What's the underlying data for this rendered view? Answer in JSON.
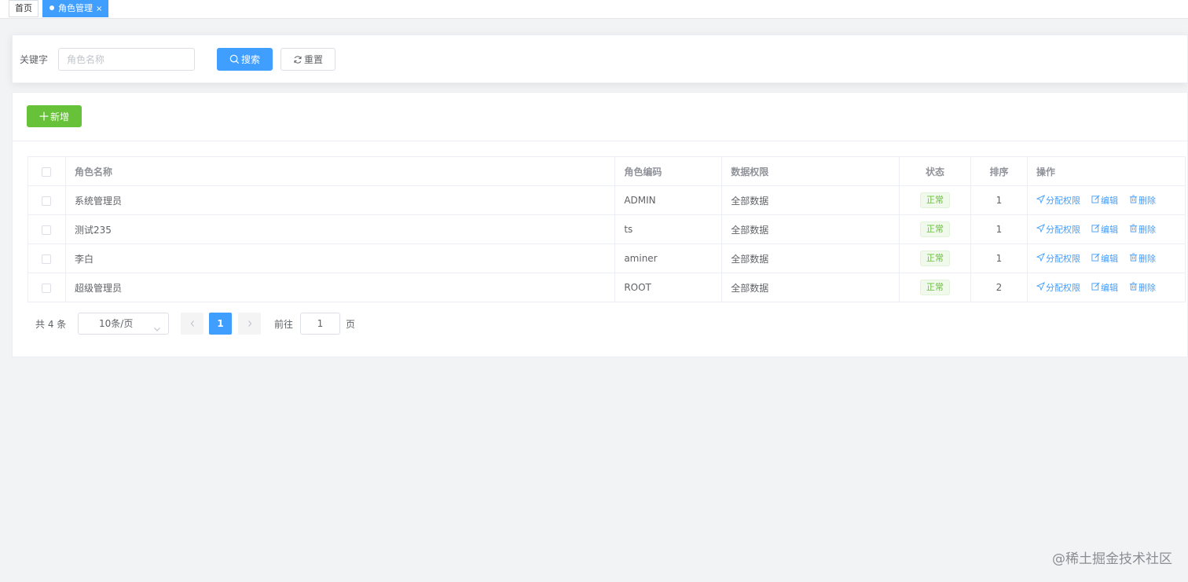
{
  "tags": {
    "home": "首页",
    "active": "角色管理",
    "close_glyph": "×"
  },
  "search": {
    "label": "关键字",
    "placeholder": "角色名称",
    "search_button": "搜索",
    "reset_button": "重置"
  },
  "toolbar": {
    "add_button": "新增"
  },
  "table": {
    "headers": [
      "角色名称",
      "角色编码",
      "数据权限",
      "状态",
      "排序",
      "操作"
    ],
    "rows": [
      {
        "name": "系统管理员",
        "code": "ADMIN",
        "scope": "全部数据",
        "status": "正常",
        "sort": "1"
      },
      {
        "name": "测试235",
        "code": "ts",
        "scope": "全部数据",
        "status": "正常",
        "sort": "1"
      },
      {
        "name": "李白",
        "code": "aminer",
        "scope": "全部数据",
        "status": "正常",
        "sort": "1"
      },
      {
        "name": "超级管理员",
        "code": "ROOT",
        "scope": "全部数据",
        "status": "正常",
        "sort": "2"
      }
    ],
    "actions": {
      "assign": "分配权限",
      "edit": "编辑",
      "delete": "删除"
    }
  },
  "pagination": {
    "total": "共 4 条",
    "page_size": "10条/页",
    "current_page": "1",
    "goto_label": "前往",
    "goto_value": "1",
    "page_suffix": "页"
  },
  "watermark": "@稀土掘金技术社区",
  "colors": {
    "primary": "#409eff",
    "success": "#67c23a",
    "background": "#f2f3f5"
  }
}
